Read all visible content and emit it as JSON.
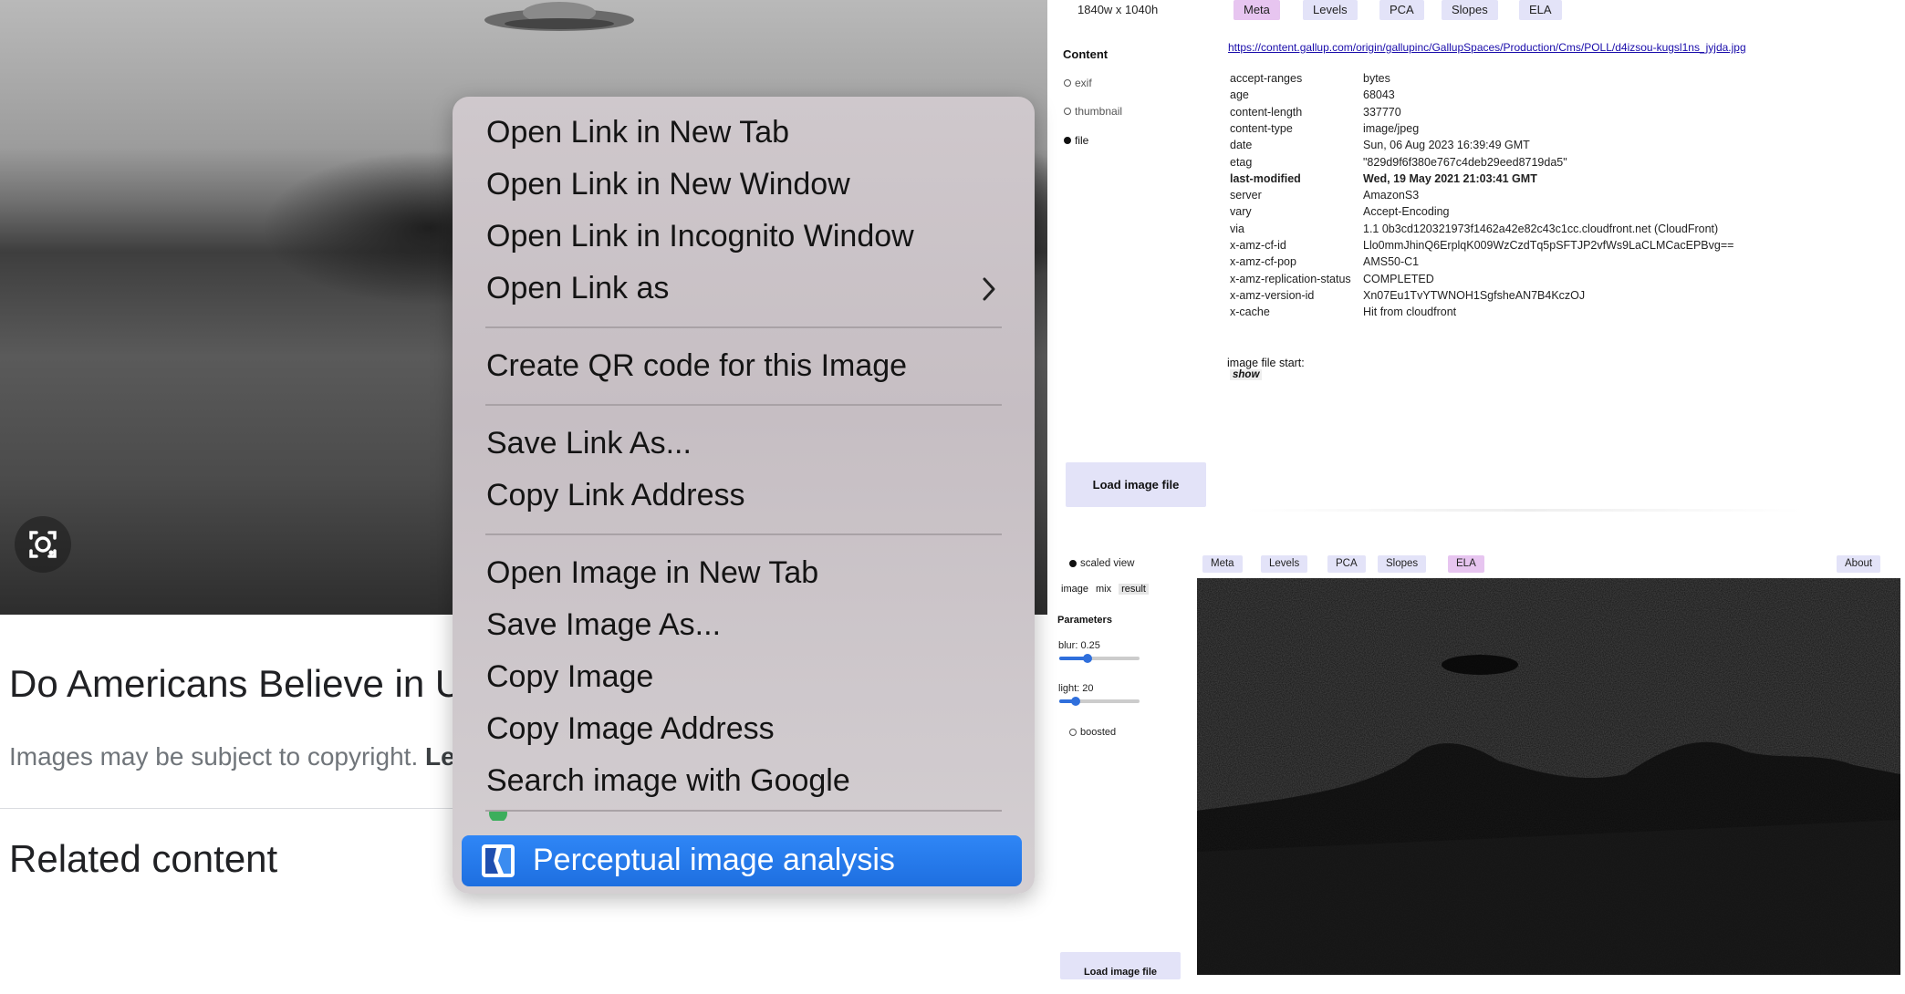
{
  "page": {
    "headline": "Do Americans Believe in U",
    "copyright_text": "Images may be subject to copyright.",
    "copyright_link": "Le",
    "related": "Related content"
  },
  "context_menu": {
    "items": [
      "Open Link in New Tab",
      "Open Link in New Window",
      "Open Link in Incognito Window",
      "Open Link as",
      "Create QR code for this Image",
      "Save Link As...",
      "Copy Link Address",
      "Open Image in New Tab",
      "Save Image As...",
      "Copy Image",
      "Copy Image Address",
      "Search image with Google"
    ],
    "highlighted": "Perceptual image analysis"
  },
  "meta_panel": {
    "dimensions": "1840w x 1040h",
    "tabs": [
      "Meta",
      "Levels",
      "PCA",
      "Slopes",
      "ELA"
    ],
    "active_tab": "Meta",
    "content_heading": "Content",
    "content_options": [
      "exif",
      "thumbnail",
      "file"
    ],
    "content_selected": "file",
    "url": "https://content.gallup.com/origin/gallupinc/GallupSpaces/Production/Cms/POLL/d4izsou-kugsl1ns_jyjda.jpg",
    "headers": [
      {
        "key": "accept-ranges",
        "value": "bytes"
      },
      {
        "key": "age",
        "value": "68043"
      },
      {
        "key": "content-length",
        "value": "337770"
      },
      {
        "key": "content-type",
        "value": "image/jpeg"
      },
      {
        "key": "date",
        "value": "Sun, 06 Aug 2023 16:39:49 GMT"
      },
      {
        "key": "etag",
        "value": "\"829d9f6f380e767c4deb29eed8719da5\""
      },
      {
        "key": "last-modified",
        "value": "Wed, 19 May 2021 21:03:41 GMT",
        "bold": true
      },
      {
        "key": "server",
        "value": "AmazonS3"
      },
      {
        "key": "vary",
        "value": "Accept-Encoding"
      },
      {
        "key": "via",
        "value": "1.1 0b3cd120321973f1462a42e82c43c1cc.cloudfront.net (CloudFront)"
      },
      {
        "key": "x-amz-cf-id",
        "value": "Llo0mmJhinQ6ErplqK009WzCzdTq5pSFTJP2vfWs9LaCLMCacEPBvg=="
      },
      {
        "key": "x-amz-cf-pop",
        "value": "AMS50-C1"
      },
      {
        "key": "x-amz-replication-status",
        "value": "COMPLETED"
      },
      {
        "key": "x-amz-version-id",
        "value": "Xn07Eu1TvYTWNOH1SgfsheAN7B4KczOJ"
      },
      {
        "key": "x-cache",
        "value": "Hit from cloudfront"
      }
    ],
    "file_start_label": "image file start:",
    "show_link": "show",
    "load_button": "Load image file"
  },
  "ela_panel": {
    "scaled_view": "scaled view",
    "tabs": [
      "Meta",
      "Levels",
      "PCA",
      "Slopes",
      "ELA"
    ],
    "active_tab": "ELA",
    "about": "About",
    "modes": [
      "image",
      "mix",
      "result"
    ],
    "active_mode": "result",
    "parameters_heading": "Parameters",
    "blur_label": "blur: 0.25",
    "blur_level": 0.35,
    "light_label": "light: 20",
    "light_level": 0.2,
    "boosted": "boosted",
    "load_button": "Load image file"
  }
}
